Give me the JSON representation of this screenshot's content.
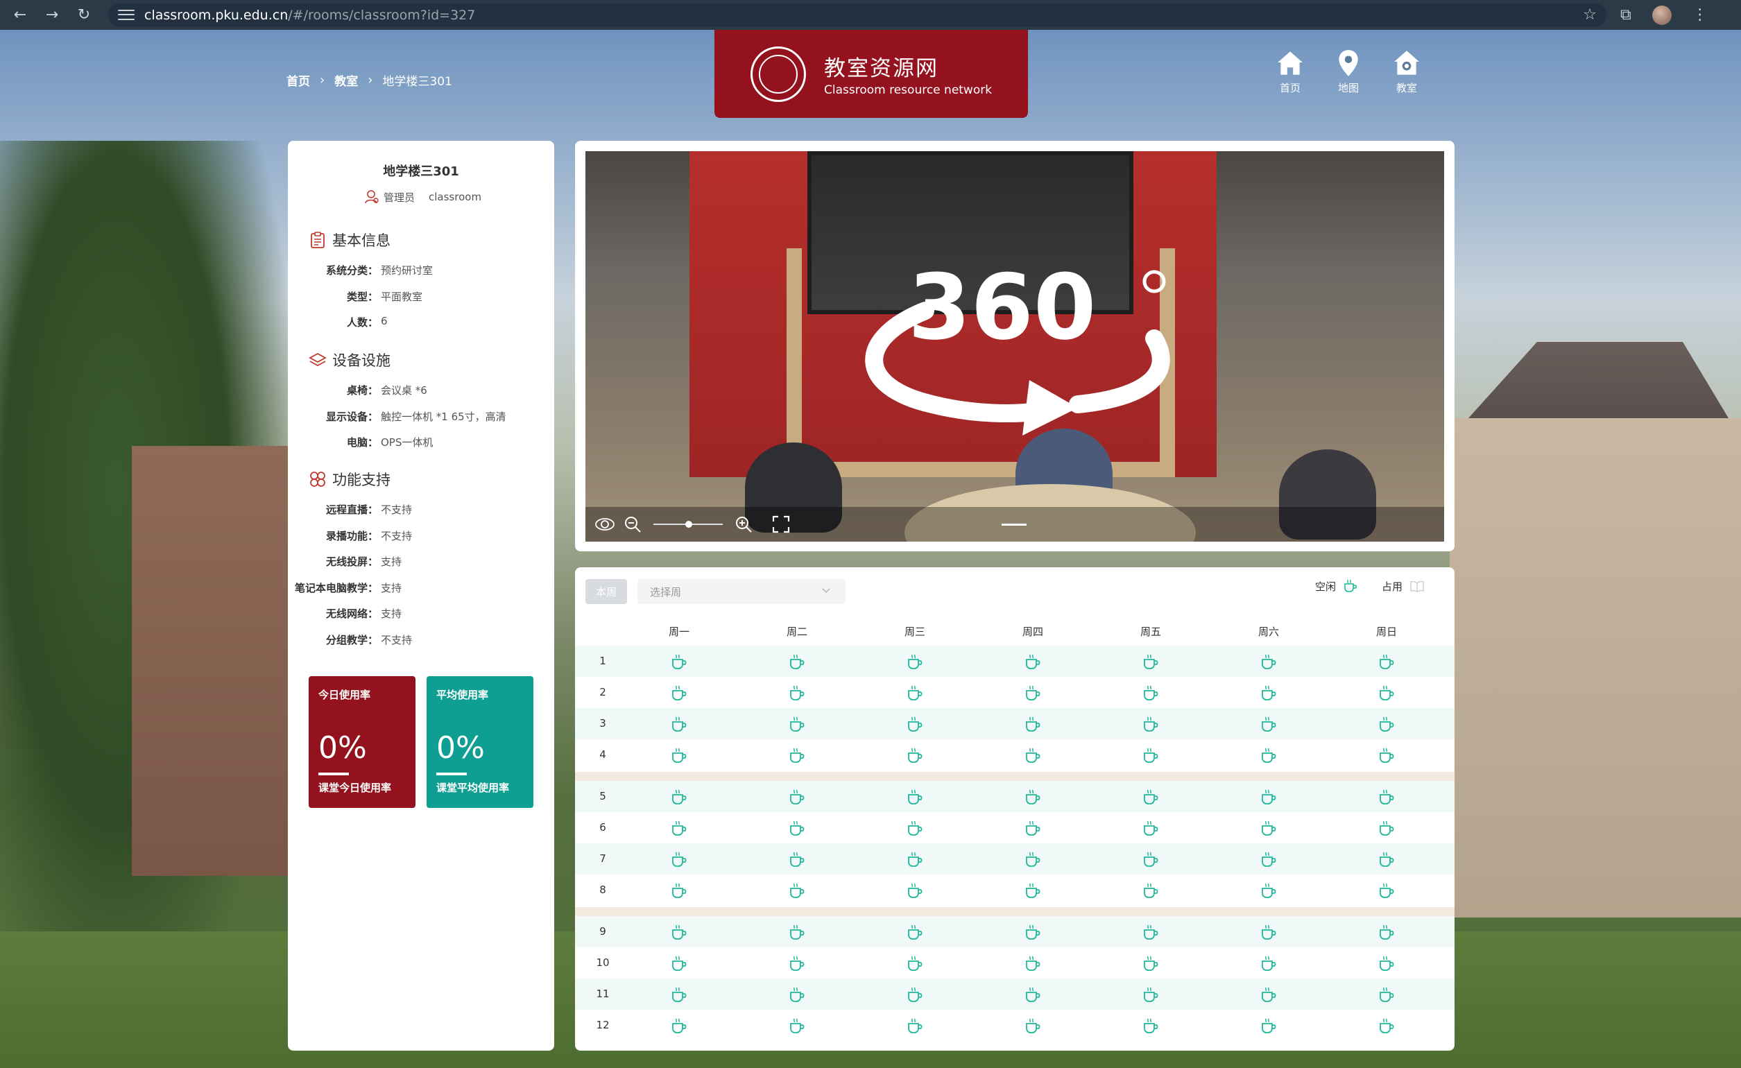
{
  "browser": {
    "url_host": "classroom.pku.edu.cn",
    "url_path": "/#/rooms/classroom?id=327"
  },
  "breadcrumb": [
    "首页",
    "教室",
    "地学楼三301"
  ],
  "logo": {
    "title": "教室资源网",
    "subtitle": "Classroom resource network"
  },
  "top_nav": [
    {
      "label": "首页",
      "icon": "home-icon"
    },
    {
      "label": "地图",
      "icon": "map-pin-icon"
    },
    {
      "label": "教室",
      "icon": "classroom-icon"
    }
  ],
  "room": {
    "title": "地学楼三301",
    "admin_label": "管理员",
    "admin_name": "classroom"
  },
  "basic_info": {
    "title": "基本信息",
    "items": [
      {
        "k": "系统分类：",
        "v": "预约研讨室"
      },
      {
        "k": "类型：",
        "v": "平面教室"
      },
      {
        "k": "人数：",
        "v": "6"
      }
    ]
  },
  "equipment": {
    "title": "设备设施",
    "items": [
      {
        "k": "桌椅：",
        "v": "会议桌 *6"
      },
      {
        "k": "显示设备：",
        "v": "触控一体机 *1 65寸，高清"
      },
      {
        "k": "电脑：",
        "v": "OPS一体机"
      }
    ]
  },
  "features": {
    "title": "功能支持",
    "items": [
      {
        "k": "远程直播：",
        "v": "不支持"
      },
      {
        "k": "录播功能：",
        "v": "不支持"
      },
      {
        "k": "无线投屏：",
        "v": "支持"
      },
      {
        "k": "笔记本电脑教学：",
        "v": "支持"
      },
      {
        "k": "无线网络：",
        "v": "支持"
      },
      {
        "k": "分组教学：",
        "v": "不支持"
      }
    ]
  },
  "stats": [
    {
      "label": "今日使用率",
      "value": "0%",
      "note": "课堂今日使用率",
      "color": "#94121e"
    },
    {
      "label": "平均使用率",
      "value": "0%",
      "note": "课堂平均使用率",
      "color": "#0f9e92"
    }
  ],
  "pano": {
    "badge": "360"
  },
  "schedule": {
    "week_button": "本周",
    "week_placeholder": "选择周",
    "legend_free": "空闲",
    "legend_busy": "占用",
    "days": [
      "周一",
      "周二",
      "周三",
      "周四",
      "周五",
      "周六",
      "周日"
    ],
    "periods": [
      "1",
      "2",
      "3",
      "4",
      "5",
      "6",
      "7",
      "8",
      "9",
      "10",
      "11",
      "12"
    ],
    "status_free_color": "#1fb89a"
  }
}
